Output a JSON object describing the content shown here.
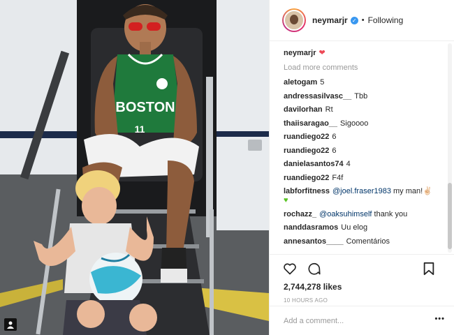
{
  "post": {
    "username": "neymarjr",
    "following_label": "Following",
    "separator": "•",
    "caption_user": "neymarjr",
    "caption_emoji": "❤",
    "load_more": "Load more comments",
    "likes": "2,744,278 likes",
    "time": "10 HOURS AGO",
    "add_comment_placeholder": "Add a comment...",
    "more_label": "•••",
    "photo_jersey_text": "BOSTON",
    "photo_jersey_number": "11"
  },
  "comments": [
    {
      "user": "aletogam",
      "text": "5"
    },
    {
      "user": "andressasilvasc__",
      "text": "Tbb"
    },
    {
      "user": "davilorhan",
      "text": "Rt"
    },
    {
      "user": "thaiisaragao__",
      "text": "Sigoooo"
    },
    {
      "user": "ruandiego22",
      "text": "6"
    },
    {
      "user": "ruandiego22",
      "text": "6"
    },
    {
      "user": "danielasantos74",
      "text": "4"
    },
    {
      "user": "ruandiego22",
      "text": "F4f"
    },
    {
      "user": "labforfitness",
      "mention": "@joel.fraser1983",
      "text": "my man!✌🏻"
    },
    {
      "user": "rochazz_",
      "mention": "@oaksuhimself",
      "text": "thank you"
    },
    {
      "user": "nanddasramos",
      "text": "Uu elog"
    },
    {
      "user": "annesantos____",
      "text": "Comentários"
    }
  ],
  "icons": {
    "verified": "verified-badge-icon",
    "like": "heart-icon",
    "comment": "comment-bubble-icon",
    "save": "bookmark-icon",
    "corner": "user-tag-icon"
  },
  "colors": {
    "verified": "#3897f0",
    "mention": "#003569",
    "muted": "#999999",
    "heart": "#ed4956"
  }
}
